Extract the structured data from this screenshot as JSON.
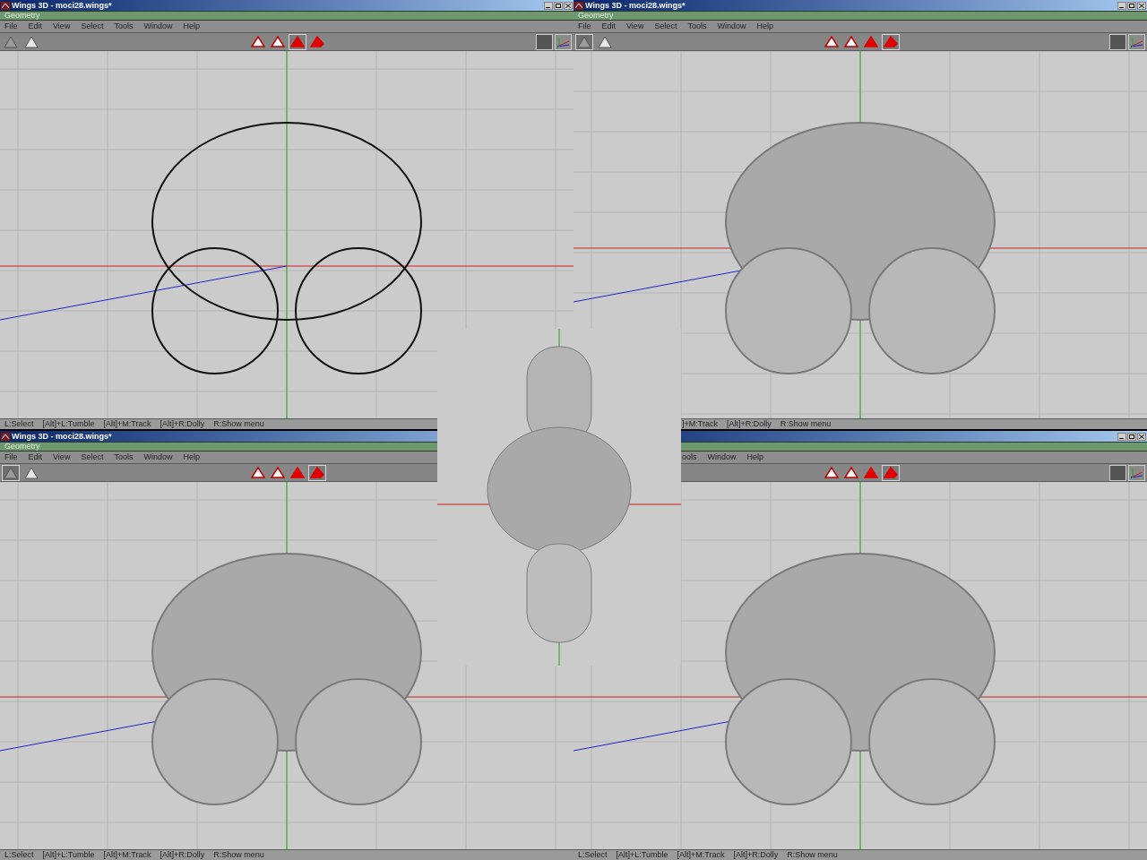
{
  "windows": [
    {
      "title": "Wings 3D - moci28.wings*",
      "mode_label": "Geometry",
      "controls_visible": true,
      "menu": [
        "File",
        "Edit",
        "View",
        "Select",
        "Tools",
        "Window",
        "Help"
      ],
      "view_buttons": [
        {
          "selected": false
        },
        {
          "selected": false
        }
      ],
      "select_modes": [
        {
          "selected": false
        },
        {
          "selected": false
        },
        {
          "selected": true
        },
        {
          "selected": false
        }
      ],
      "status": [
        "L:Select",
        "[Alt]+L:Tumble",
        "[Alt]+M:Track",
        "[Alt]+R:Dolly",
        "R:Show menu"
      ]
    },
    {
      "title": "Wings 3D - moci28.wings*",
      "mode_label": "Geometry",
      "controls_visible": true,
      "menu": [
        "File",
        "Edit",
        "View",
        "Select",
        "Tools",
        "Window",
        "Help"
      ],
      "view_buttons": [
        {
          "selected": true
        },
        {
          "selected": false
        }
      ],
      "select_modes": [
        {
          "selected": false
        },
        {
          "selected": false
        },
        {
          "selected": false
        },
        {
          "selected": true
        }
      ],
      "status": [
        "]+M:Track",
        "[Alt]+R:Dolly",
        "R:Show menu"
      ]
    },
    {
      "title": "Wings 3D - moci28.wings*",
      "mode_label": "Geometry",
      "controls_visible": false,
      "menu": [
        "File",
        "Edit",
        "View",
        "Select",
        "Tools",
        "Window",
        "Help"
      ],
      "view_buttons": [
        {
          "selected": true
        },
        {
          "selected": false
        }
      ],
      "select_modes": [
        {
          "selected": false
        },
        {
          "selected": false
        },
        {
          "selected": false
        },
        {
          "selected": true
        }
      ],
      "status": [
        "L:Select",
        "[Alt]+L:Tumble",
        "[Alt]+M:Track",
        "[Alt]+R:Dolly",
        "R:Show menu"
      ]
    },
    {
      "controls_visible": true,
      "menu": [
        "ools",
        "Window",
        "Help"
      ],
      "select_modes": [
        {
          "selected": false
        },
        {
          "selected": false
        },
        {
          "selected": false
        },
        {
          "selected": true
        }
      ],
      "status": [
        "L:Select",
        "[Alt]+L:Tumble",
        "[Alt]+M:Track",
        "[Alt]+R:Dolly",
        "R:Show menu"
      ]
    }
  ]
}
